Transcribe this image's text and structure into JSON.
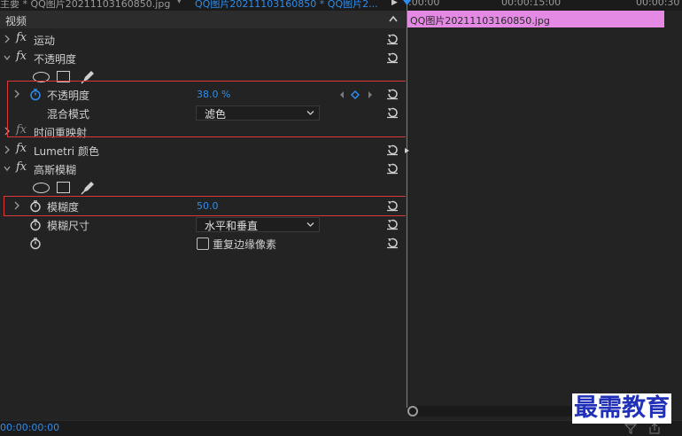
{
  "top_bar": {
    "master_tab": "主要 * QQ图片20211103160850.jpg",
    "separator_glyph": "▾",
    "clip_tab": "QQ图片20211103160850 * QQ图片2...",
    "play_glyph": "▶",
    "tc_start": ":00:00",
    "tc_mid": "00:00:15:00",
    "tc_end": "00:00:30"
  },
  "effect_controls": {
    "section_label": "视频",
    "motion": "运动",
    "opacity": {
      "label": "不透明度",
      "prop_label": "不透明度",
      "value": "38.0 %",
      "blend_label": "混合模式",
      "blend_value": "滤色"
    },
    "time_remap": "时间重映射",
    "lumetri": "Lumetri 颜色",
    "gaussian": {
      "label": "高斯模糊",
      "blur_label": "模糊度",
      "blur_value": "50.0",
      "dim_label": "模糊尺寸",
      "dim_value": "水平和垂直",
      "repeat_edge": "重复边缘像素"
    }
  },
  "timeline": {
    "clip_name": "QQ图片20211103160850.jpg",
    "clip_color": "#e48ae4"
  },
  "bottom_bar": {
    "timecode": "00:00:00:00"
  },
  "watermark": "最需教育",
  "colors": {
    "accent": "#2d8ceb",
    "highlight_box": "#d83a3a",
    "panel_bg": "#232323"
  }
}
